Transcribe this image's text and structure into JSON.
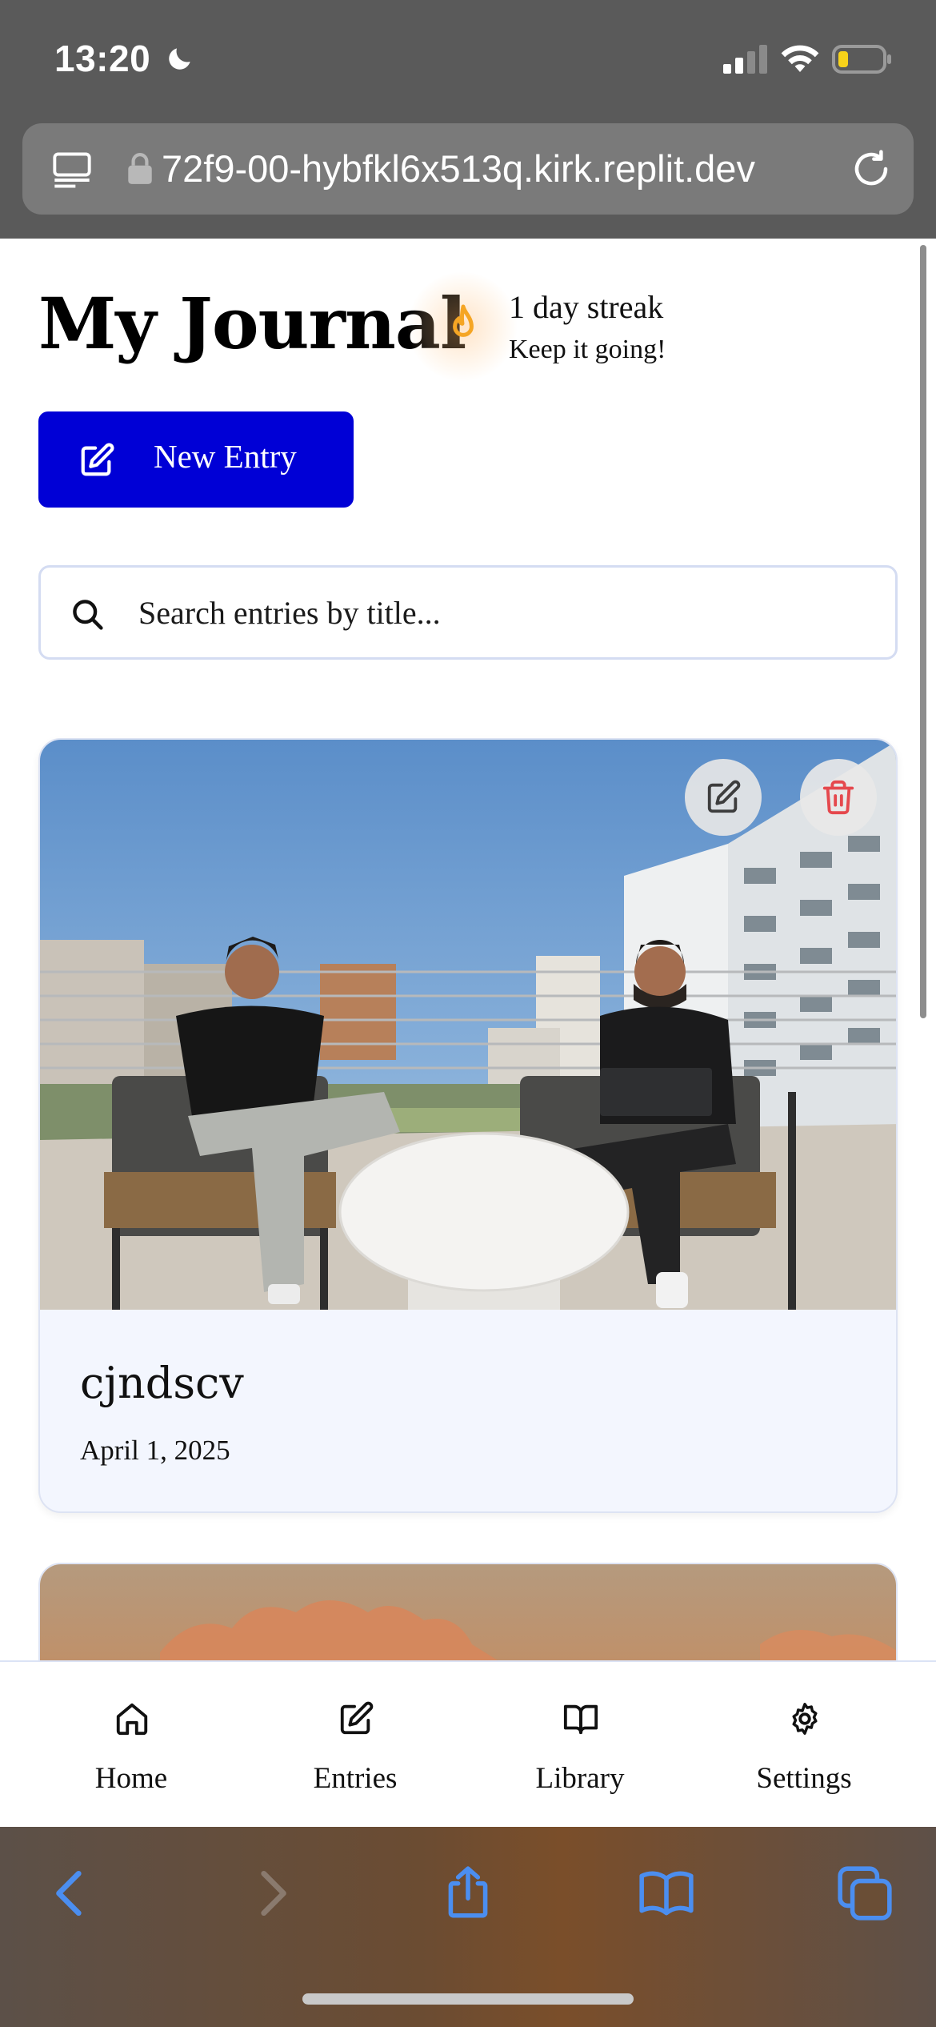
{
  "status_bar": {
    "time": "13:20"
  },
  "browser": {
    "url": "72f9-00-hybfkl6x513q.kirk.replit.dev"
  },
  "header": {
    "title": "My Journal",
    "streak_title": "1 day streak",
    "streak_subtitle": "Keep it going!"
  },
  "actions": {
    "new_entry_label": "New Entry"
  },
  "search": {
    "placeholder": "Search entries by title..."
  },
  "entries": [
    {
      "title": "cjndscv",
      "date": "April 1, 2025"
    }
  ],
  "bottom_nav": [
    {
      "label": "Home",
      "icon": "home-icon"
    },
    {
      "label": "Entries",
      "icon": "edit-icon"
    },
    {
      "label": "Library",
      "icon": "book-icon"
    },
    {
      "label": "Settings",
      "icon": "gear-icon"
    }
  ],
  "colors": {
    "primary_button": "#0000d6",
    "delete_red": "#e5484d",
    "flame_orange": "#f5a524",
    "safari_blue": "#3b82f6"
  }
}
